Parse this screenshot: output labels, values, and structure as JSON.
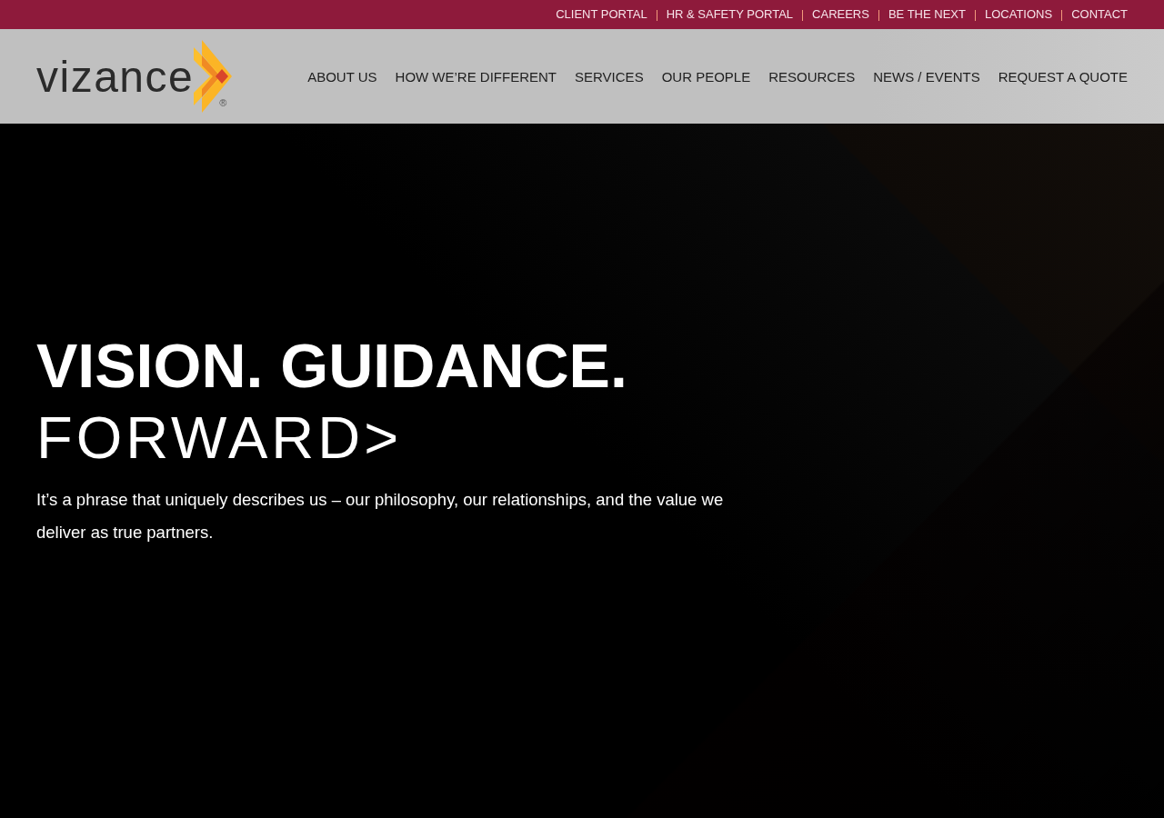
{
  "top_bar": {
    "links": [
      "CLIENT PORTAL",
      "HR & SAFETY PORTAL",
      "CAREERS",
      "BE THE NEXT",
      "LOCATIONS",
      "CONTACT"
    ]
  },
  "header": {
    "logo": {
      "wordmark": "vizance",
      "registered": "®"
    },
    "nav": [
      "ABOUT US",
      "HOW WE’RE DIFFERENT",
      "SERVICES",
      "OUR PEOPLE",
      "RESOURCES",
      "NEWS / EVENTS",
      "REQUEST A QUOTE"
    ]
  },
  "hero": {
    "headline": "VISION. GUIDANCE.",
    "tagline": "FORWARD>",
    "body": "It’s a phrase that uniquely describes us – our philosophy, our relationships, and the value we deliver as true partners."
  }
}
